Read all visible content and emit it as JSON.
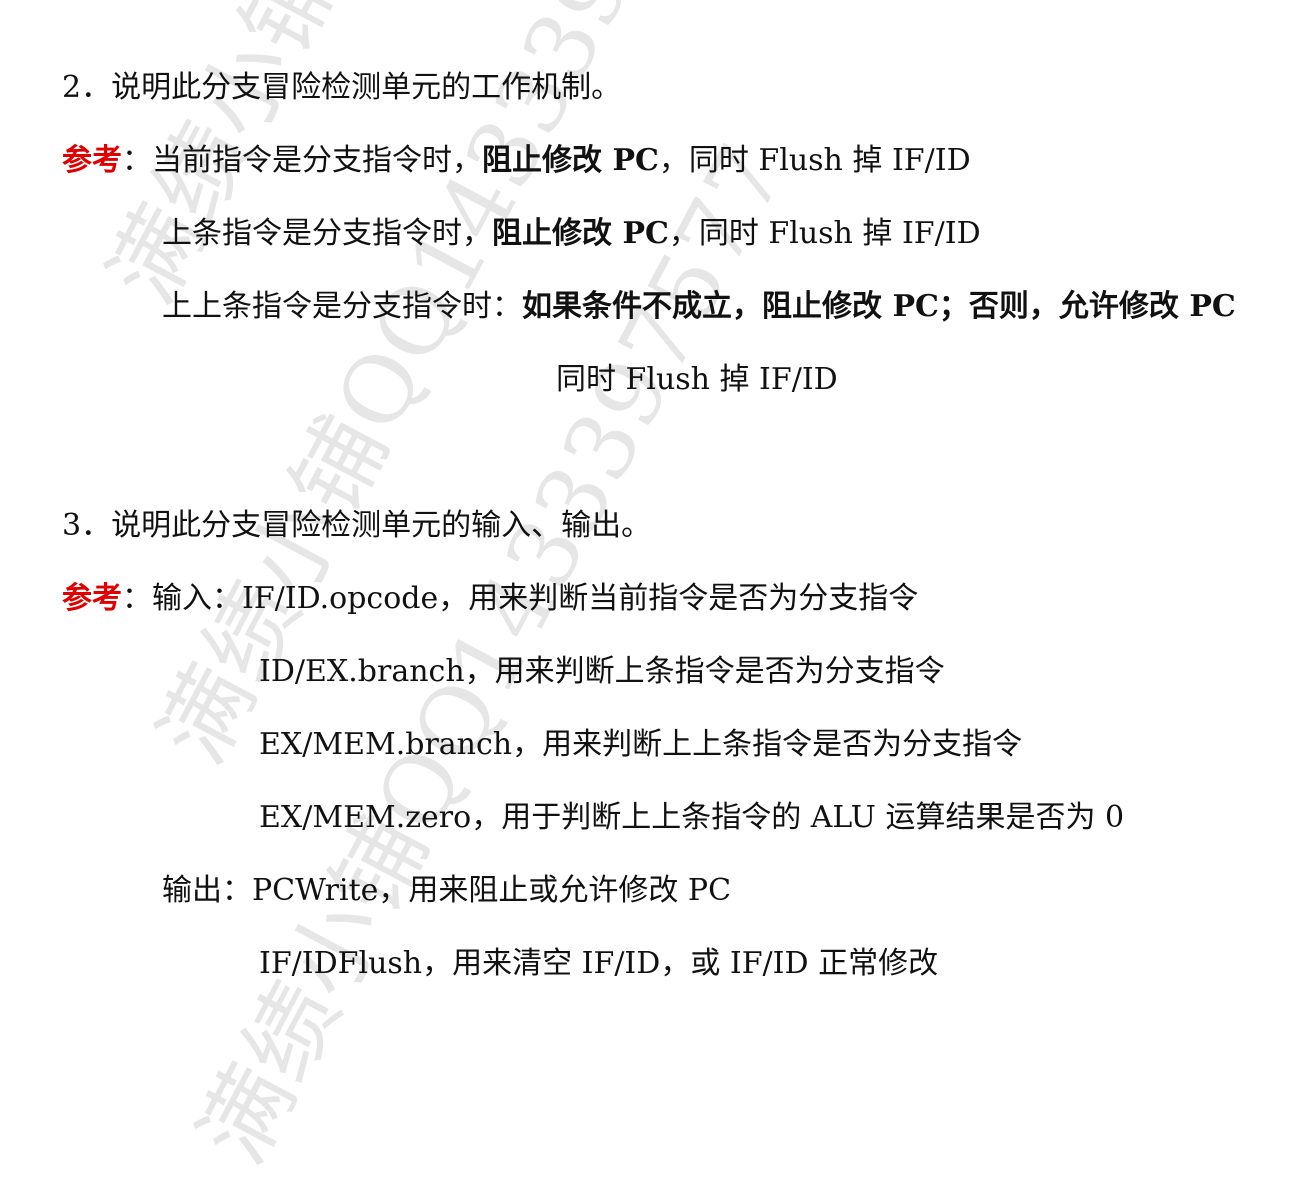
{
  "watermark": "满绩小铺QQ1433397577",
  "colors": {
    "label_red": "#e00000",
    "text": "#111111",
    "watermark": "#e6e6e6"
  },
  "q2": {
    "title": "2．说明此分支冒险检测单元的工作机制。",
    "ref_label": "参考",
    "colon": "：",
    "line1": {
      "a": "当前指令是分支指令时，",
      "b": "阻止修改 PC",
      "c": "，同时 Flush 掉 IF/ID"
    },
    "line2": {
      "a": "上条指令是分支指令时，",
      "b": "阻止修改 PC",
      "c": "，同时 Flush 掉 IF/ID"
    },
    "line3": {
      "a": "上上条指令是分支指令时：",
      "b": "如果条件不成立，阻止修改 PC；否则，允许修改 PC"
    },
    "line4": "同时 Flush 掉 IF/ID"
  },
  "q3": {
    "title": "3．说明此分支冒险检测单元的输入、输出。",
    "ref_label": "参考",
    "colon": "：",
    "input_label": "输入：",
    "inputs": [
      "IF/ID.opcode，用来判断当前指令是否为分支指令",
      "ID/EX.branch，用来判断上条指令是否为分支指令",
      "EX/MEM.branch，用来判断上上条指令是否为分支指令",
      "EX/MEM.zero，用于判断上上条指令的 ALU 运算结果是否为 0"
    ],
    "output_label": "输出：",
    "outputs": [
      "PCWrite，用来阻止或允许修改 PC",
      "IF/IDFlush，用来清空 IF/ID，或 IF/ID 正常修改"
    ]
  }
}
